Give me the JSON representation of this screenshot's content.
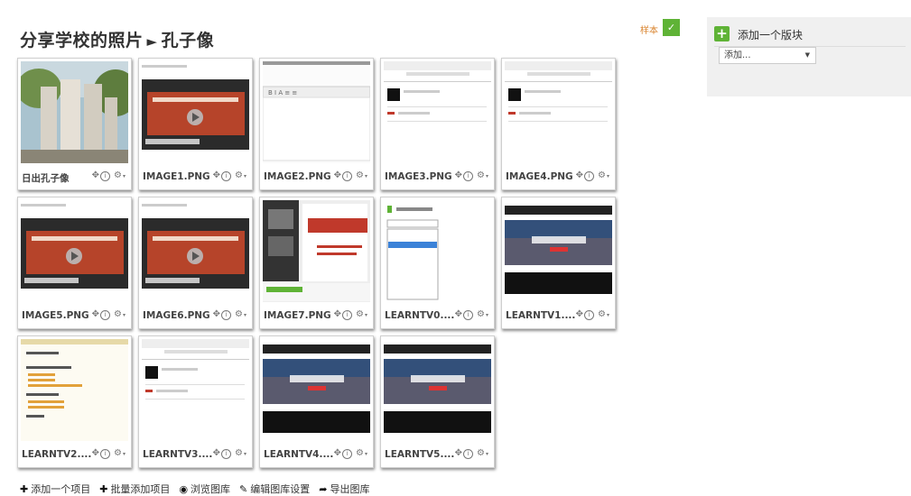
{
  "title": {
    "part1": "分享学校的照片",
    "separator": "►",
    "part2": "孔子像"
  },
  "sample": {
    "label": "样本",
    "check_icon": "check-icon"
  },
  "block": {
    "title": "添加一个版块",
    "select_value": "添加..."
  },
  "gallery": [
    {
      "caption": "日出孔子像",
      "kind": "photo"
    },
    {
      "caption": "IMAGE1.PNG",
      "kind": "video-screenshot"
    },
    {
      "caption": "IMAGE2.PNG",
      "kind": "editor-screenshot"
    },
    {
      "caption": "IMAGE3.PNG",
      "kind": "page-screenshot"
    },
    {
      "caption": "IMAGE4.PNG",
      "kind": "page-screenshot"
    },
    {
      "caption": "IMAGE5.PNG",
      "kind": "video-screenshot"
    },
    {
      "caption": "IMAGE6.PNG",
      "kind": "video-screenshot"
    },
    {
      "caption": "IMAGE7.PNG",
      "kind": "slide-screenshot"
    },
    {
      "caption": "LEARNTV0....",
      "kind": "menu-screenshot"
    },
    {
      "caption": "LEARNTV1....",
      "kind": "crowd-screenshot"
    },
    {
      "caption": "LEARNTV2....",
      "kind": "list-screenshot"
    },
    {
      "caption": "LEARNTV3....",
      "kind": "page-screenshot"
    },
    {
      "caption": "LEARNTV4....",
      "kind": "crowd-screenshot"
    },
    {
      "caption": "LEARNTV5....",
      "kind": "crowd-screenshot"
    }
  ],
  "card_actions": {
    "move": "move-icon",
    "info": "info-icon",
    "settings": "gear-icon"
  },
  "footer": [
    {
      "icon": "plus-icon",
      "label": "添加一个项目"
    },
    {
      "icon": "plus-icon",
      "label": "批量添加项目"
    },
    {
      "icon": "eye-icon",
      "label": "浏览图库"
    },
    {
      "icon": "edit-icon",
      "label": "编辑图库设置"
    },
    {
      "icon": "share-icon",
      "label": "导出图库"
    }
  ]
}
